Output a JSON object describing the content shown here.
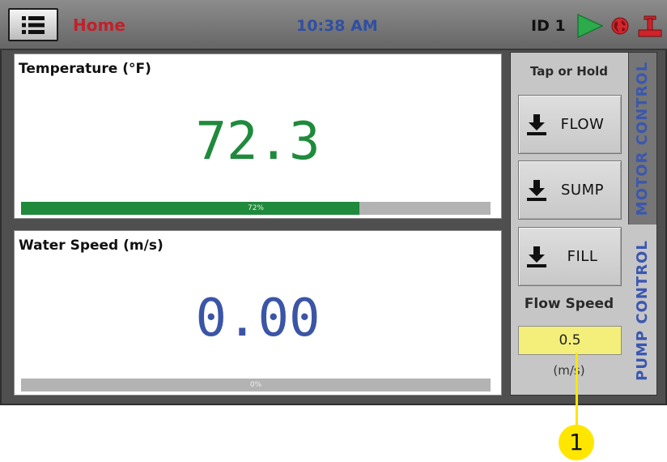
{
  "header": {
    "menu_icon": "menu-icon",
    "home_label": "Home",
    "time": "10:38 AM",
    "id_label": "ID 1",
    "status_icons": [
      "play-icon",
      "globe-icon",
      "valve-icon"
    ]
  },
  "panels": [
    {
      "title": "Temperature (°F)",
      "value": "72.3",
      "progress": 72,
      "progress_label": "72%",
      "value_color": "#1f8a3c"
    },
    {
      "title": "Water Speed (m/s)",
      "value": "0.00",
      "progress": 0,
      "progress_label": "0%",
      "value_color": "#3b55a6"
    }
  ],
  "control": {
    "header": "Tap or Hold",
    "buttons": [
      {
        "label": "FLOW",
        "icon": "download-arrow-icon"
      },
      {
        "label": "SUMP",
        "icon": "download-arrow-icon"
      },
      {
        "label": "FILL",
        "icon": "download-arrow-icon"
      }
    ],
    "flow_speed_label": "Flow Speed",
    "flow_speed_value": "0.5",
    "flow_speed_unit": "(m/s)",
    "tabs": [
      {
        "label": "MOTOR CONTROL",
        "active": false
      },
      {
        "label": "PUMP CONTROL",
        "active": true
      }
    ]
  },
  "callout": {
    "label": "1"
  },
  "colors": {
    "home": "#c3202b",
    "time": "#2f4fa5",
    "tab_text": "#3a57b0",
    "input_bg": "#f4ef7a",
    "callout": "#ffe600"
  }
}
